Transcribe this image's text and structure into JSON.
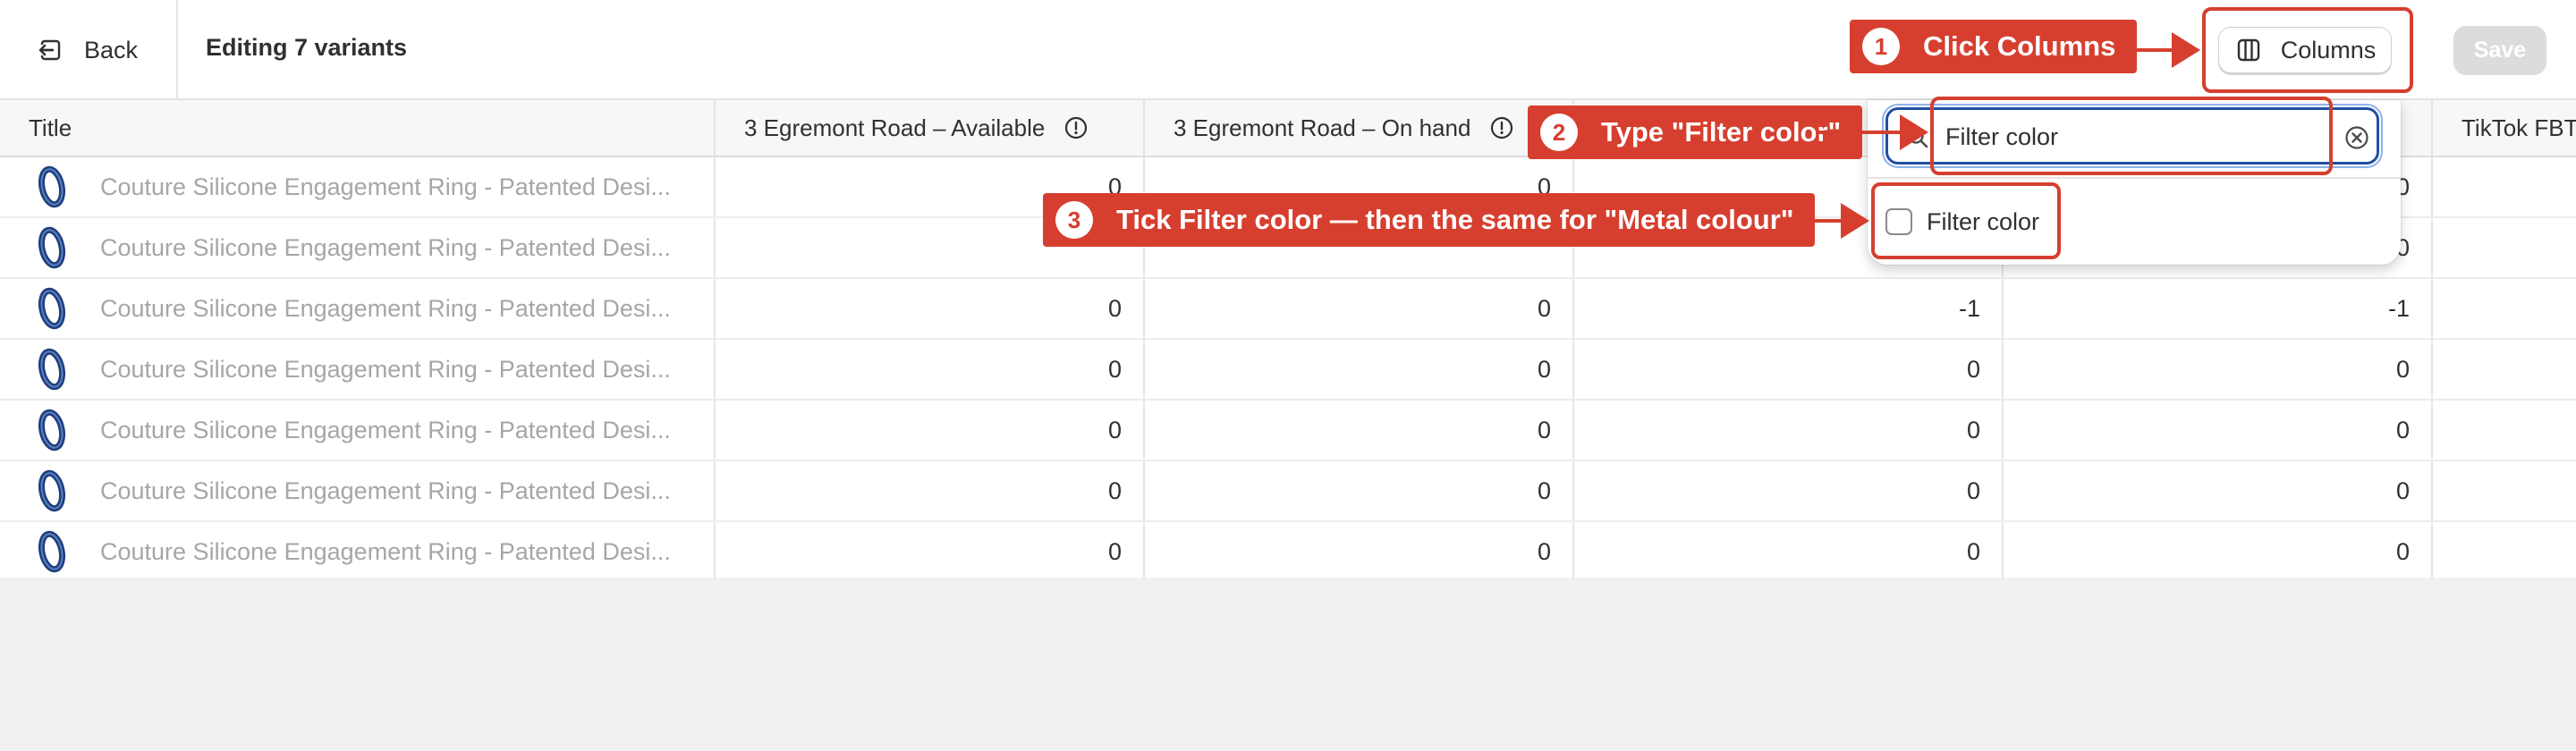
{
  "topbar": {
    "back_label": "Back",
    "title": "Editing 7 variants",
    "columns_label": "Columns",
    "save_label": "Save"
  },
  "table": {
    "headers": [
      "Title",
      "3 Egremont Road – Available",
      "3 Egremont Road – On hand",
      "",
      "",
      "TikTok FBT"
    ],
    "product_title": "Couture Silicone Engagement Ring - Patented Desi...",
    "rows": [
      [
        "0",
        "0",
        "",
        "0"
      ],
      [
        "",
        "",
        "",
        "0"
      ],
      [
        "0",
        "0",
        "-1",
        "-1"
      ],
      [
        "0",
        "0",
        "0",
        "0"
      ],
      [
        "0",
        "0",
        "0",
        "0"
      ],
      [
        "0",
        "0",
        "0",
        "0"
      ],
      [
        "0",
        "0",
        "0",
        "0"
      ]
    ]
  },
  "columns_popover": {
    "search_value": "Filter color",
    "option_label": "Filter color"
  },
  "annotations": {
    "step1": {
      "number": "1",
      "text": "Click Columns"
    },
    "step2": {
      "number": "2",
      "text": "Type \"Filter color\""
    },
    "step3": {
      "number": "3",
      "text": "Tick Filter color — then the same for \"Metal colour\""
    }
  },
  "colors": {
    "accent_red": "#d63f2f",
    "focus_blue": "#1f4fa3",
    "ring_navy": "#1f3e7c"
  },
  "icons": {
    "back": "back-arrow-icon",
    "columns": "columns-icon",
    "info": "info-circle-icon",
    "search": "search-icon",
    "clear": "clear-circle-icon",
    "thumb": "ring-thumbnail"
  }
}
